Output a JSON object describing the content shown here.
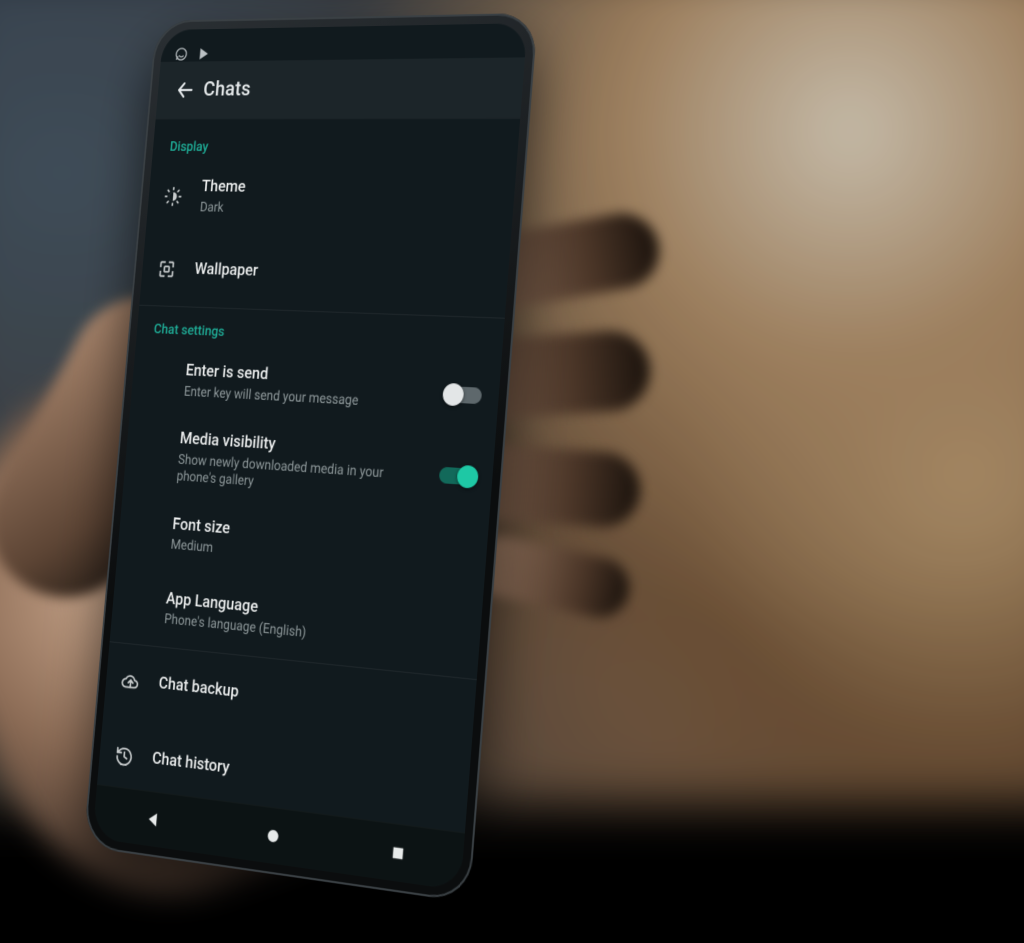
{
  "colors": {
    "accent": "#1FAE98",
    "toggle_on": "#1EC8A5",
    "bg": "#111A1E"
  },
  "statusbar": {
    "icons": [
      "whatsapp-icon",
      "play-store-icon"
    ]
  },
  "appbar": {
    "title": "Chats"
  },
  "sections": [
    {
      "header": "Display",
      "items": [
        {
          "key": "theme",
          "icon": "brightness-icon",
          "title": "Theme",
          "sub": "Dark"
        },
        {
          "key": "wallpaper",
          "icon": "wallpaper-icon",
          "title": "Wallpaper",
          "sub": ""
        }
      ]
    },
    {
      "header": "Chat settings",
      "items": [
        {
          "key": "enter_send",
          "title": "Enter is send",
          "sub": "Enter key will send your message",
          "toggle": false
        },
        {
          "key": "media_vis",
          "title": "Media visibility",
          "sub": "Show newly downloaded media in your phone's gallery",
          "toggle": true
        },
        {
          "key": "font_size",
          "title": "Font size",
          "sub": "Medium"
        },
        {
          "key": "app_lang",
          "title": "App Language",
          "sub": "Phone's language (English)"
        }
      ]
    },
    {
      "header": "",
      "items": [
        {
          "key": "backup",
          "icon": "cloud-upload-icon",
          "title": "Chat backup",
          "sub": ""
        },
        {
          "key": "history",
          "icon": "history-icon",
          "title": "Chat history",
          "sub": ""
        }
      ]
    }
  ]
}
